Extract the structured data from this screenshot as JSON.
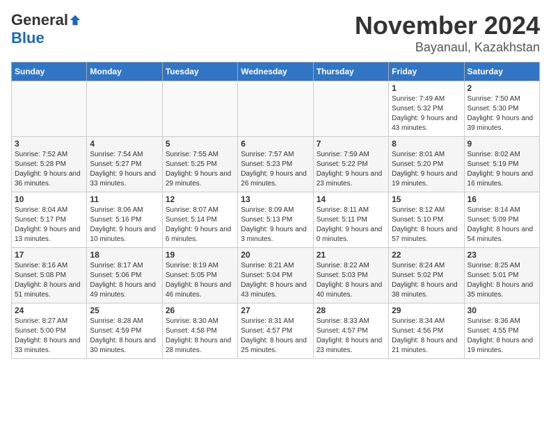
{
  "logo": {
    "general": "General",
    "blue": "Blue"
  },
  "title": "November 2024",
  "location": "Bayanaul, Kazakhstan",
  "headers": [
    "Sunday",
    "Monday",
    "Tuesday",
    "Wednesday",
    "Thursday",
    "Friday",
    "Saturday"
  ],
  "weeks": [
    [
      {
        "day": "",
        "info": ""
      },
      {
        "day": "",
        "info": ""
      },
      {
        "day": "",
        "info": ""
      },
      {
        "day": "",
        "info": ""
      },
      {
        "day": "",
        "info": ""
      },
      {
        "day": "1",
        "info": "Sunrise: 7:49 AM\nSunset: 5:32 PM\nDaylight: 9 hours and 43 minutes."
      },
      {
        "day": "2",
        "info": "Sunrise: 7:50 AM\nSunset: 5:30 PM\nDaylight: 9 hours and 39 minutes."
      }
    ],
    [
      {
        "day": "3",
        "info": "Sunrise: 7:52 AM\nSunset: 5:28 PM\nDaylight: 9 hours and 36 minutes."
      },
      {
        "day": "4",
        "info": "Sunrise: 7:54 AM\nSunset: 5:27 PM\nDaylight: 9 hours and 33 minutes."
      },
      {
        "day": "5",
        "info": "Sunrise: 7:55 AM\nSunset: 5:25 PM\nDaylight: 9 hours and 29 minutes."
      },
      {
        "day": "6",
        "info": "Sunrise: 7:57 AM\nSunset: 5:23 PM\nDaylight: 9 hours and 26 minutes."
      },
      {
        "day": "7",
        "info": "Sunrise: 7:59 AM\nSunset: 5:22 PM\nDaylight: 9 hours and 23 minutes."
      },
      {
        "day": "8",
        "info": "Sunrise: 8:01 AM\nSunset: 5:20 PM\nDaylight: 9 hours and 19 minutes."
      },
      {
        "day": "9",
        "info": "Sunrise: 8:02 AM\nSunset: 5:19 PM\nDaylight: 9 hours and 16 minutes."
      }
    ],
    [
      {
        "day": "10",
        "info": "Sunrise: 8:04 AM\nSunset: 5:17 PM\nDaylight: 9 hours and 13 minutes."
      },
      {
        "day": "11",
        "info": "Sunrise: 8:06 AM\nSunset: 5:16 PM\nDaylight: 9 hours and 10 minutes."
      },
      {
        "day": "12",
        "info": "Sunrise: 8:07 AM\nSunset: 5:14 PM\nDaylight: 9 hours and 6 minutes."
      },
      {
        "day": "13",
        "info": "Sunrise: 8:09 AM\nSunset: 5:13 PM\nDaylight: 9 hours and 3 minutes."
      },
      {
        "day": "14",
        "info": "Sunrise: 8:11 AM\nSunset: 5:11 PM\nDaylight: 9 hours and 0 minutes."
      },
      {
        "day": "15",
        "info": "Sunrise: 8:12 AM\nSunset: 5:10 PM\nDaylight: 8 hours and 57 minutes."
      },
      {
        "day": "16",
        "info": "Sunrise: 8:14 AM\nSunset: 5:09 PM\nDaylight: 8 hours and 54 minutes."
      }
    ],
    [
      {
        "day": "17",
        "info": "Sunrise: 8:16 AM\nSunset: 5:08 PM\nDaylight: 8 hours and 51 minutes."
      },
      {
        "day": "18",
        "info": "Sunrise: 8:17 AM\nSunset: 5:06 PM\nDaylight: 8 hours and 49 minutes."
      },
      {
        "day": "19",
        "info": "Sunrise: 8:19 AM\nSunset: 5:05 PM\nDaylight: 8 hours and 46 minutes."
      },
      {
        "day": "20",
        "info": "Sunrise: 8:21 AM\nSunset: 5:04 PM\nDaylight: 8 hours and 43 minutes."
      },
      {
        "day": "21",
        "info": "Sunrise: 8:22 AM\nSunset: 5:03 PM\nDaylight: 8 hours and 40 minutes."
      },
      {
        "day": "22",
        "info": "Sunrise: 8:24 AM\nSunset: 5:02 PM\nDaylight: 8 hours and 38 minutes."
      },
      {
        "day": "23",
        "info": "Sunrise: 8:25 AM\nSunset: 5:01 PM\nDaylight: 8 hours and 35 minutes."
      }
    ],
    [
      {
        "day": "24",
        "info": "Sunrise: 8:27 AM\nSunset: 5:00 PM\nDaylight: 8 hours and 33 minutes."
      },
      {
        "day": "25",
        "info": "Sunrise: 8:28 AM\nSunset: 4:59 PM\nDaylight: 8 hours and 30 minutes."
      },
      {
        "day": "26",
        "info": "Sunrise: 8:30 AM\nSunset: 4:58 PM\nDaylight: 8 hours and 28 minutes."
      },
      {
        "day": "27",
        "info": "Sunrise: 8:31 AM\nSunset: 4:57 PM\nDaylight: 8 hours and 25 minutes."
      },
      {
        "day": "28",
        "info": "Sunrise: 8:33 AM\nSunset: 4:57 PM\nDaylight: 8 hours and 23 minutes."
      },
      {
        "day": "29",
        "info": "Sunrise: 8:34 AM\nSunset: 4:56 PM\nDaylight: 8 hours and 21 minutes."
      },
      {
        "day": "30",
        "info": "Sunrise: 8:36 AM\nSunset: 4:55 PM\nDaylight: 8 hours and 19 minutes."
      }
    ]
  ]
}
